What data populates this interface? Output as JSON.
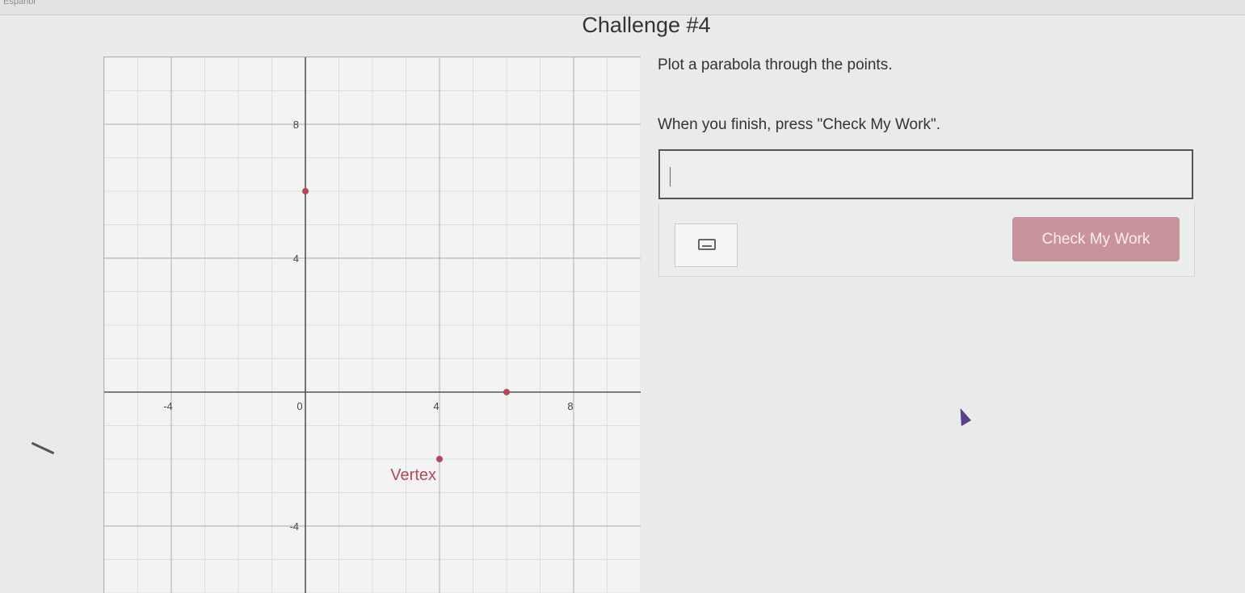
{
  "header": {
    "topbar_text": "Español",
    "title": "Challenge #4"
  },
  "instructions": {
    "line1": "Plot a parabola through the points.",
    "line2": "When you finish, press \"Check My Work\"."
  },
  "answer": {
    "input_value": "",
    "check_button_label": "Check My Work"
  },
  "icons": {
    "keyboard": "keyboard-icon",
    "cursor": "pointer-cursor-icon"
  },
  "colors": {
    "point": "#b04a5a",
    "vertex_label": "#b04a5a",
    "check_button": "#c9939c"
  },
  "graph": {
    "x_range": [
      -6,
      10
    ],
    "y_range": [
      -6,
      10
    ],
    "x_tick_labels": [
      {
        "value": -4,
        "label": "-4"
      },
      {
        "value": 0,
        "label": "0"
      },
      {
        "value": 4,
        "label": "4"
      },
      {
        "value": 8,
        "label": "8"
      }
    ],
    "y_tick_labels": [
      {
        "value": 8,
        "label": "8"
      },
      {
        "value": 4,
        "label": "4"
      },
      {
        "value": -4,
        "label": "-4"
      }
    ],
    "points": [
      {
        "x": 0,
        "y": 6
      },
      {
        "x": 6,
        "y": 0
      },
      {
        "x": 4,
        "y": -2
      }
    ],
    "vertex": {
      "x": 4,
      "y": -2,
      "label": "Vertex"
    }
  }
}
